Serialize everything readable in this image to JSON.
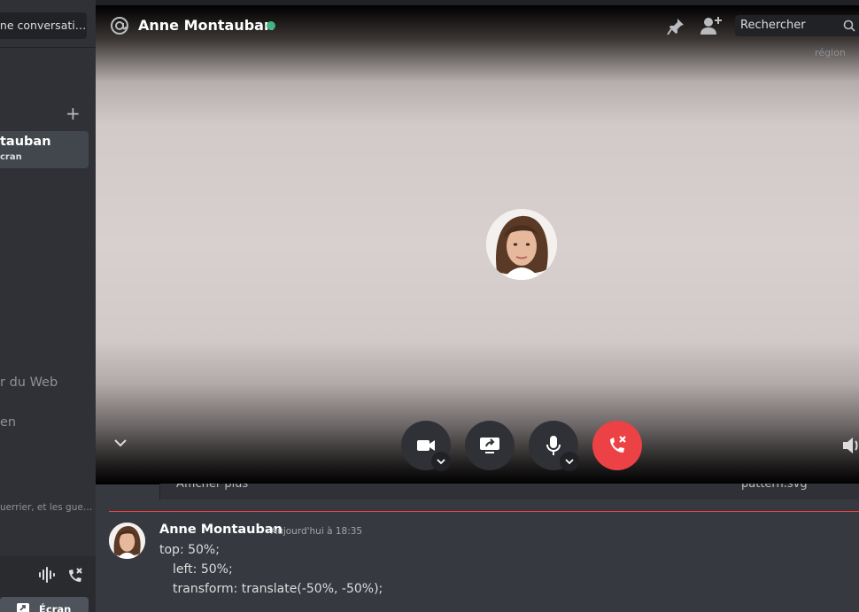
{
  "sidebar": {
    "search_placeholder": "une conversati…",
    "active_dm": {
      "name": "tauban",
      "subtitle": "cran"
    },
    "items": [
      "r du Web",
      "en"
    ],
    "preview_snippet": "uerrier, et les gue…",
    "screen_label": "Écran"
  },
  "header": {
    "name": "Anne Montauban",
    "status": "online",
    "search_placeholder": "Rechercher",
    "region_label": "région"
  },
  "call_controls": {
    "buttons": [
      "camera",
      "screen-share",
      "microphone",
      "hang-up"
    ]
  },
  "chat": {
    "attachment_row": {
      "left": "Afficher plus",
      "right": "pattern.svg"
    },
    "message": {
      "author": "Anne Montauban",
      "timestamp": "Aujourd'hui à 18:35",
      "lines": [
        "top: 50%;",
        "left: 50%;",
        "transform: translate(-50%, -50%);"
      ]
    }
  },
  "colors": {
    "background": "#36393f",
    "sidebar": "#2f3136",
    "online": "#43b581",
    "hangup": "#ed4245",
    "new_messages_divider": "#ed4245"
  },
  "icons": [
    "at-icon",
    "pin-icon",
    "add-user-icon",
    "search-icon",
    "chevron-down-icon",
    "camera-icon",
    "screen-share-icon",
    "microphone-icon",
    "hang-up-icon",
    "volume-icon",
    "soundwave-icon",
    "phone-x-icon",
    "screen-icon",
    "plus-icon"
  ]
}
